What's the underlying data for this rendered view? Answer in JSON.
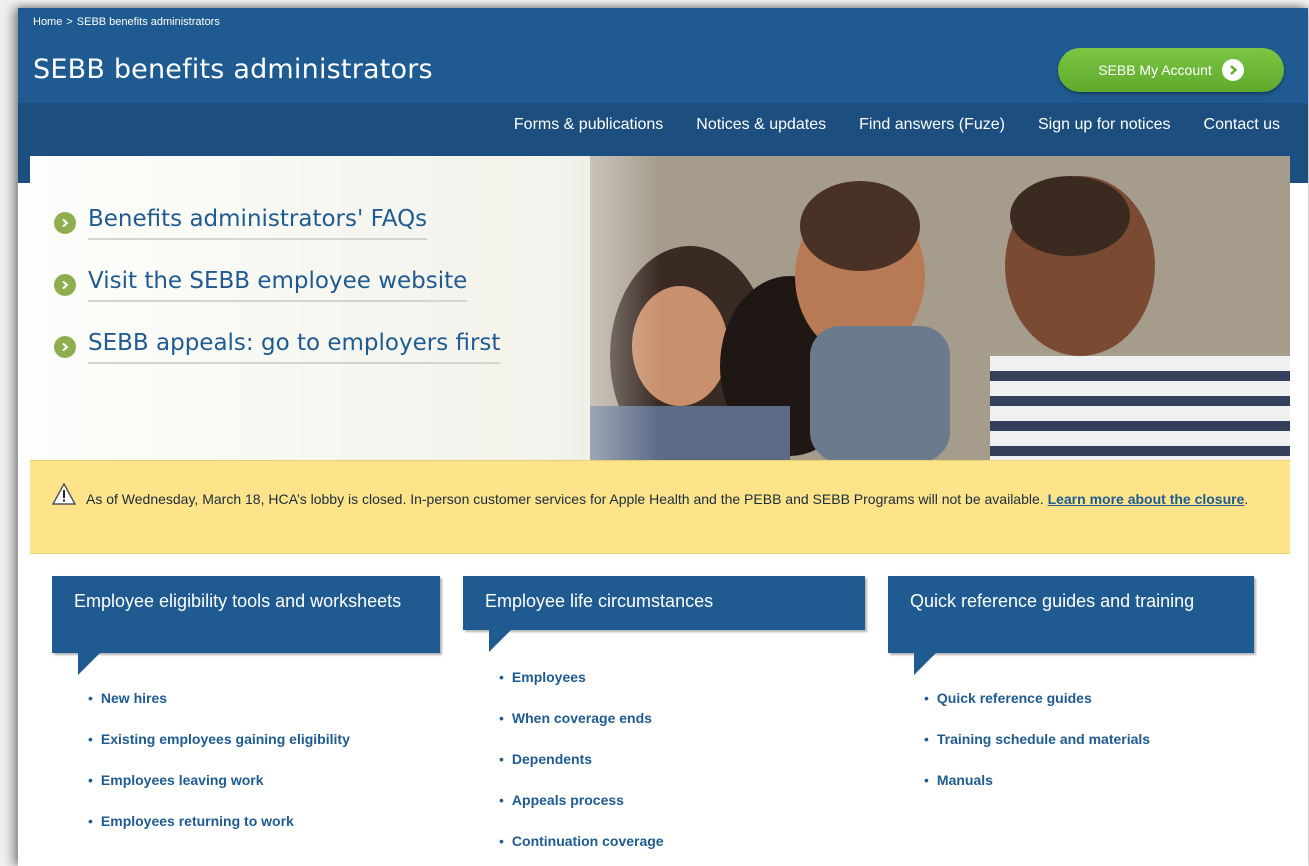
{
  "breadcrumb": {
    "home": "Home",
    "separator": ">",
    "current": "SEBB benefits administrators"
  },
  "header": {
    "title": "SEBB benefits administrators",
    "account_button": "SEBB My Account"
  },
  "nav": {
    "items": [
      "Forms & publications",
      "Notices & updates",
      "Find answers (Fuze)",
      "Sign up for notices",
      "Contact us"
    ]
  },
  "hero": {
    "links": [
      "Benefits administrators' FAQs",
      "Visit the SEBB employee website",
      "SEBB appeals: go to employers first"
    ]
  },
  "alert": {
    "text": "As of Wednesday, March 18, HCA’s lobby is closed. In-person customer services for Apple Health and the PEBB and SEBB Programs will not be available.",
    "link_text": "Learn more about the closure",
    "trailing": "."
  },
  "cards": [
    {
      "title": "Employee eligibility tools and worksheets",
      "items": [
        "New hires",
        "Existing employees gaining eligibility",
        "Employees leaving work",
        "Employees returning to work"
      ]
    },
    {
      "title": "Employee life circumstances",
      "items": [
        "Employees",
        "When coverage ends",
        "Dependents",
        "Appeals process",
        "Continuation coverage"
      ]
    },
    {
      "title": "Quick reference guides and training",
      "items": [
        "Quick reference guides",
        "Training schedule and materials",
        "Manuals"
      ]
    }
  ],
  "colors": {
    "primary": "#1f5b90",
    "nav": "#1c4f7f",
    "account_green": "#6ab535",
    "alert_bg": "#fde48b",
    "bullet_green": "#8fae4f"
  }
}
